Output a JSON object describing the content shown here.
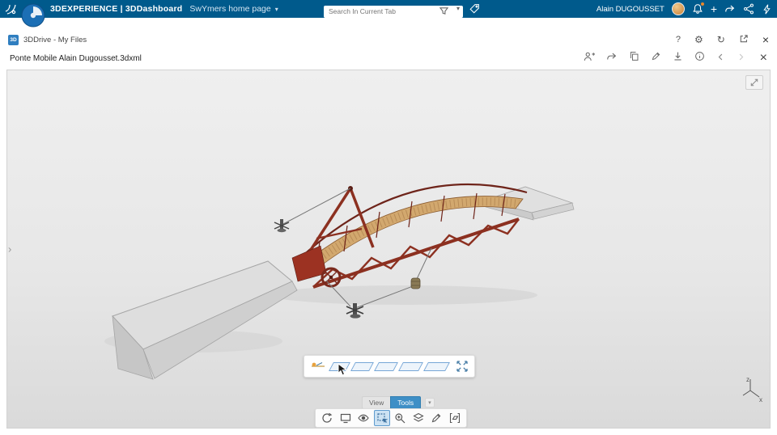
{
  "topbar": {
    "brand": "3DEXPERIENCE | 3DDashboard",
    "page_title": "SwYmers home page",
    "chevron_glyph": "▾",
    "search": {
      "placeholder": "Search In Current Tab",
      "dropdown_glyph": "▾"
    },
    "user_name": "Alain DUGOUSSET",
    "add_glyph": "+"
  },
  "window_bar": {
    "app_badge": "3D",
    "app_label": "3DDrive - My Files",
    "help_glyph": "?",
    "gear_glyph": "⚙",
    "refresh_glyph": "↻",
    "close_glyph": "×"
  },
  "doc_bar": {
    "title": "Ponte Mobile Alain Dugousset.3dxml",
    "close_glyph": "×"
  },
  "viewer": {
    "left_chevron_glyph": "›",
    "tabs": {
      "view": "View",
      "tools": "Tools",
      "menu_glyph": "▾"
    },
    "axis": {
      "z": "z",
      "x": "x"
    }
  },
  "colors": {
    "topbar_blue": "#005a8c",
    "accent_blue": "#3e8fc6",
    "tool_active_bg": "#cce2f3",
    "notification_orange": "#e8872a",
    "bridge_red": "#8c3020",
    "deck_tan": "#d2a86e",
    "ramp_gray": "#dcdcdc"
  }
}
